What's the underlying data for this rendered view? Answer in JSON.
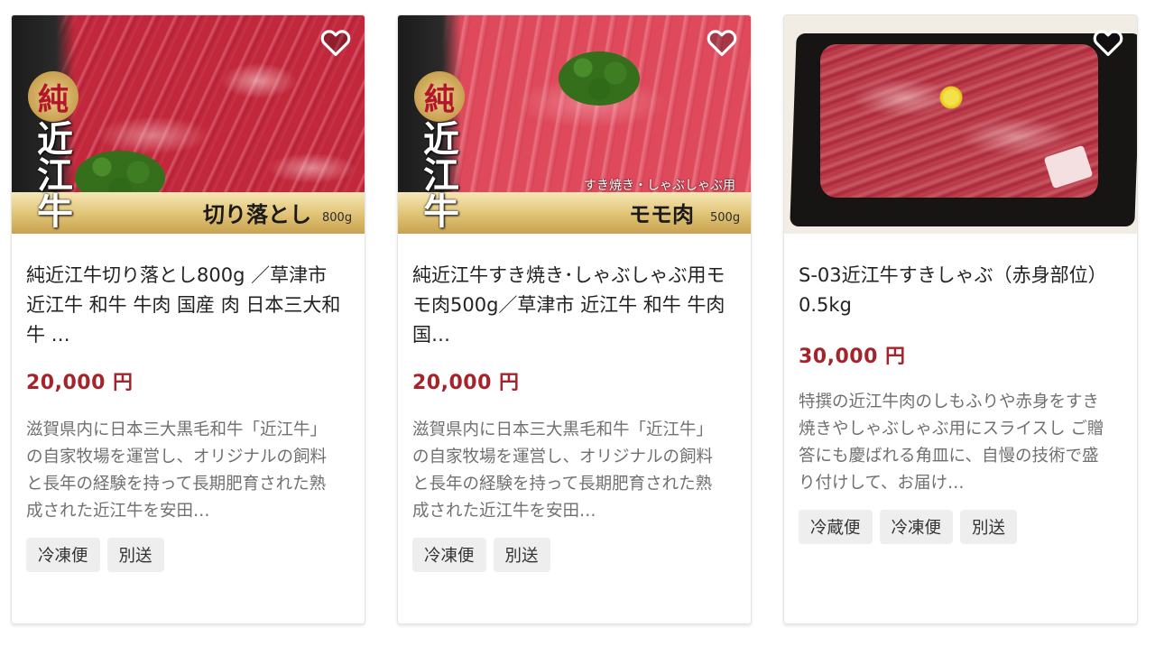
{
  "products": [
    {
      "image_text": {
        "seal": "純",
        "brand": "近\n江\n牛",
        "band_title": "切り落とし",
        "band_weight": "800g",
        "band_sub": ""
      },
      "title": "純近江牛切り落とし800g ／草津市 近江牛 和牛 牛肉 国産 肉 日本三大和牛 …",
      "price": "20,000 円",
      "description": "滋賀県内に日本三大黒毛和牛「近江牛」の自家牧場を運営し、オリジナルの飼料と長年の経験を持って長期肥育された熟成された近江牛を安田…",
      "tags": [
        "冷凍便",
        "別送"
      ],
      "favorite_icon": "heart-outline-icon"
    },
    {
      "image_text": {
        "seal": "純",
        "brand": "近\n江\n牛",
        "band_title": "モモ肉",
        "band_weight": "500g",
        "band_sub": "すき焼き・しゃぶしゃぶ用"
      },
      "title": "純近江牛すき焼き･しゃぶしゃぶ用モモ肉500g／草津市 近江牛 和牛 牛肉 国…",
      "price": "20,000 円",
      "description": "滋賀県内に日本三大黒毛和牛「近江牛」の自家牧場を運営し、オリジナルの飼料と長年の経験を持って長期肥育された熟成された近江牛を安田…",
      "tags": [
        "冷凍便",
        "別送"
      ],
      "favorite_icon": "heart-outline-icon"
    },
    {
      "title": "S-03近江牛すきしゃぶ（赤身部位）0.5kg",
      "price": "30,000 円",
      "description": "特撰の近江牛肉のしもふりや赤身をすき焼きやしゃぶしゃぶ用にスライスし ご贈答にも慶ばれる角皿に、自慢の技術で盛り付けして、お届け…",
      "tags": [
        "冷蔵便",
        "冷凍便",
        "別送"
      ],
      "favorite_icon": "heart-outline-icon"
    }
  ],
  "colors": {
    "price": "#a5232b",
    "tag_bg": "#eeeeee",
    "desc_text": "#707070"
  }
}
